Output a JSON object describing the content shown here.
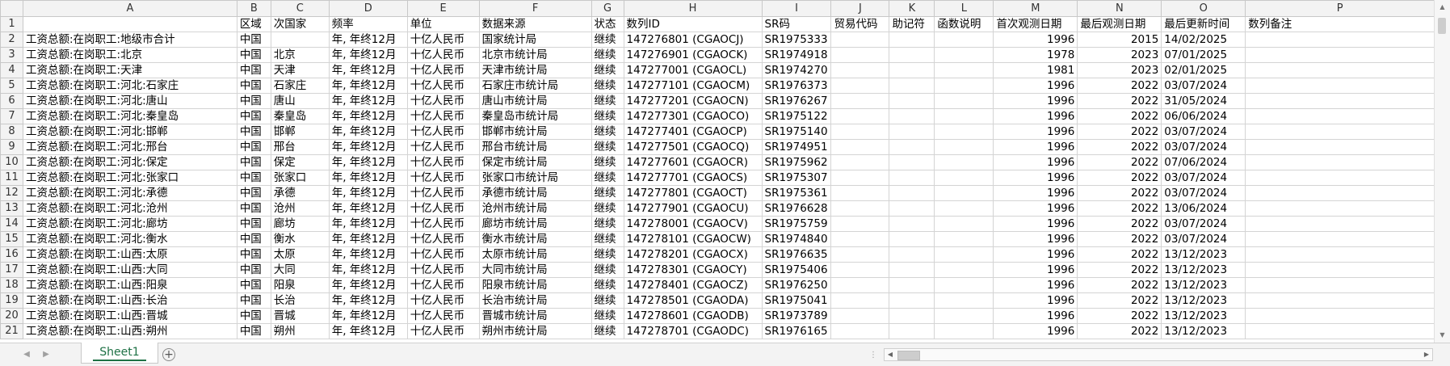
{
  "columns": [
    "A",
    "B",
    "C",
    "D",
    "E",
    "F",
    "G",
    "H",
    "I",
    "J",
    "K",
    "L",
    "M",
    "N",
    "O",
    "P"
  ],
  "rows": [
    {
      "num": "1",
      "cells": [
        "",
        "区域",
        "次国家",
        "频率",
        "单位",
        "数据来源",
        "状态",
        "数列ID",
        "SR码",
        "贸易代码",
        "助记符",
        "函数说明",
        "首次观测日期",
        "最后观测日期",
        "最后更新时间",
        "数列备注"
      ]
    },
    {
      "num": "2",
      "cells": [
        "工资总额:在岗职工:地级市合计",
        "中国",
        "",
        "年, 年终12月",
        "十亿人民币",
        "国家统计局",
        "继续",
        "147276801 (CGAOCJ)",
        "SR1975333",
        "",
        "",
        "",
        "1996",
        "2015",
        "14/02/2025",
        ""
      ]
    },
    {
      "num": "3",
      "cells": [
        "工资总额:在岗职工:北京",
        "中国",
        "北京",
        "年, 年终12月",
        "十亿人民币",
        "北京市统计局",
        "继续",
        "147276901 (CGAOCK)",
        "SR1974918",
        "",
        "",
        "",
        "1978",
        "2023",
        "07/01/2025",
        ""
      ]
    },
    {
      "num": "4",
      "cells": [
        "工资总额:在岗职工:天津",
        "中国",
        "天津",
        "年, 年终12月",
        "十亿人民币",
        "天津市统计局",
        "继续",
        "147277001 (CGAOCL)",
        "SR1974270",
        "",
        "",
        "",
        "1981",
        "2023",
        "02/01/2025",
        ""
      ]
    },
    {
      "num": "5",
      "cells": [
        "工资总额:在岗职工:河北:石家庄",
        "中国",
        "石家庄",
        "年, 年终12月",
        "十亿人民币",
        "石家庄市统计局",
        "继续",
        "147277101 (CGAOCM)",
        "SR1976373",
        "",
        "",
        "",
        "1996",
        "2022",
        "03/07/2024",
        ""
      ]
    },
    {
      "num": "6",
      "cells": [
        "工资总额:在岗职工:河北:唐山",
        "中国",
        "唐山",
        "年, 年终12月",
        "十亿人民币",
        "唐山市统计局",
        "继续",
        "147277201 (CGAOCN)",
        "SR1976267",
        "",
        "",
        "",
        "1996",
        "2022",
        "31/05/2024",
        ""
      ]
    },
    {
      "num": "7",
      "cells": [
        "工资总额:在岗职工:河北:秦皇岛",
        "中国",
        "秦皇岛",
        "年, 年终12月",
        "十亿人民币",
        "秦皇岛市统计局",
        "继续",
        "147277301 (CGAOCO)",
        "SR1975122",
        "",
        "",
        "",
        "1996",
        "2022",
        "06/06/2024",
        ""
      ]
    },
    {
      "num": "8",
      "cells": [
        "工资总额:在岗职工:河北:邯郸",
        "中国",
        "邯郸",
        "年, 年终12月",
        "十亿人民币",
        "邯郸市统计局",
        "继续",
        "147277401 (CGAOCP)",
        "SR1975140",
        "",
        "",
        "",
        "1996",
        "2022",
        "03/07/2024",
        ""
      ]
    },
    {
      "num": "9",
      "cells": [
        "工资总额:在岗职工:河北:邢台",
        "中国",
        "邢台",
        "年, 年终12月",
        "十亿人民币",
        "邢台市统计局",
        "继续",
        "147277501 (CGAOCQ)",
        "SR1974951",
        "",
        "",
        "",
        "1996",
        "2022",
        "03/07/2024",
        ""
      ]
    },
    {
      "num": "10",
      "cells": [
        "工资总额:在岗职工:河北:保定",
        "中国",
        "保定",
        "年, 年终12月",
        "十亿人民币",
        "保定市统计局",
        "继续",
        "147277601 (CGAOCR)",
        "SR1975962",
        "",
        "",
        "",
        "1996",
        "2022",
        "07/06/2024",
        ""
      ]
    },
    {
      "num": "11",
      "cells": [
        "工资总额:在岗职工:河北:张家口",
        "中国",
        "张家口",
        "年, 年终12月",
        "十亿人民币",
        "张家口市统计局",
        "继续",
        "147277701 (CGAOCS)",
        "SR1975307",
        "",
        "",
        "",
        "1996",
        "2022",
        "03/07/2024",
        ""
      ]
    },
    {
      "num": "12",
      "cells": [
        "工资总额:在岗职工:河北:承德",
        "中国",
        "承德",
        "年, 年终12月",
        "十亿人民币",
        "承德市统计局",
        "继续",
        "147277801 (CGAOCT)",
        "SR1975361",
        "",
        "",
        "",
        "1996",
        "2022",
        "03/07/2024",
        ""
      ]
    },
    {
      "num": "13",
      "cells": [
        "工资总额:在岗职工:河北:沧州",
        "中国",
        "沧州",
        "年, 年终12月",
        "十亿人民币",
        "沧州市统计局",
        "继续",
        "147277901 (CGAOCU)",
        "SR1976628",
        "",
        "",
        "",
        "1996",
        "2022",
        "13/06/2024",
        ""
      ]
    },
    {
      "num": "14",
      "cells": [
        "工资总额:在岗职工:河北:廊坊",
        "中国",
        "廊坊",
        "年, 年终12月",
        "十亿人民币",
        "廊坊市统计局",
        "继续",
        "147278001 (CGAOCV)",
        "SR1975759",
        "",
        "",
        "",
        "1996",
        "2022",
        "03/07/2024",
        ""
      ]
    },
    {
      "num": "15",
      "cells": [
        "工资总额:在岗职工:河北:衡水",
        "中国",
        "衡水",
        "年, 年终12月",
        "十亿人民币",
        "衡水市统计局",
        "继续",
        "147278101 (CGAOCW)",
        "SR1974840",
        "",
        "",
        "",
        "1996",
        "2022",
        "03/07/2024",
        ""
      ]
    },
    {
      "num": "16",
      "cells": [
        "工资总额:在岗职工:山西:太原",
        "中国",
        "太原",
        "年, 年终12月",
        "十亿人民币",
        "太原市统计局",
        "继续",
        "147278201 (CGAOCX)",
        "SR1976635",
        "",
        "",
        "",
        "1996",
        "2022",
        "13/12/2023",
        ""
      ]
    },
    {
      "num": "17",
      "cells": [
        "工资总额:在岗职工:山西:大同",
        "中国",
        "大同",
        "年, 年终12月",
        "十亿人民币",
        "大同市统计局",
        "继续",
        "147278301 (CGAOCY)",
        "SR1975406",
        "",
        "",
        "",
        "1996",
        "2022",
        "13/12/2023",
        ""
      ]
    },
    {
      "num": "18",
      "cells": [
        "工资总额:在岗职工:山西:阳泉",
        "中国",
        "阳泉",
        "年, 年终12月",
        "十亿人民币",
        "阳泉市统计局",
        "继续",
        "147278401 (CGAOCZ)",
        "SR1976250",
        "",
        "",
        "",
        "1996",
        "2022",
        "13/12/2023",
        ""
      ]
    },
    {
      "num": "19",
      "cells": [
        "工资总额:在岗职工:山西:长治",
        "中国",
        "长治",
        "年, 年终12月",
        "十亿人民币",
        "长治市统计局",
        "继续",
        "147278501 (CGAODA)",
        "SR1975041",
        "",
        "",
        "",
        "1996",
        "2022",
        "13/12/2023",
        ""
      ]
    },
    {
      "num": "20",
      "cells": [
        "工资总额:在岗职工:山西:晋城",
        "中国",
        "晋城",
        "年, 年终12月",
        "十亿人民币",
        "晋城市统计局",
        "继续",
        "147278601 (CGAODB)",
        "SR1973789",
        "",
        "",
        "",
        "1996",
        "2022",
        "13/12/2023",
        ""
      ]
    },
    {
      "num": "21",
      "cells": [
        "工资总额:在岗职工:山西:朔州",
        "中国",
        "朔州",
        "年, 年终12月",
        "十亿人民币",
        "朔州市统计局",
        "继续",
        "147278701 (CGAODC)",
        "SR1976165",
        "",
        "",
        "",
        "1996",
        "2022",
        "13/12/2023",
        ""
      ]
    }
  ],
  "sheet_tab": "Sheet1",
  "colors": {
    "accent": "#1e7145",
    "header_bg": "#f3f3f3",
    "grid": "#d4d4d4"
  }
}
